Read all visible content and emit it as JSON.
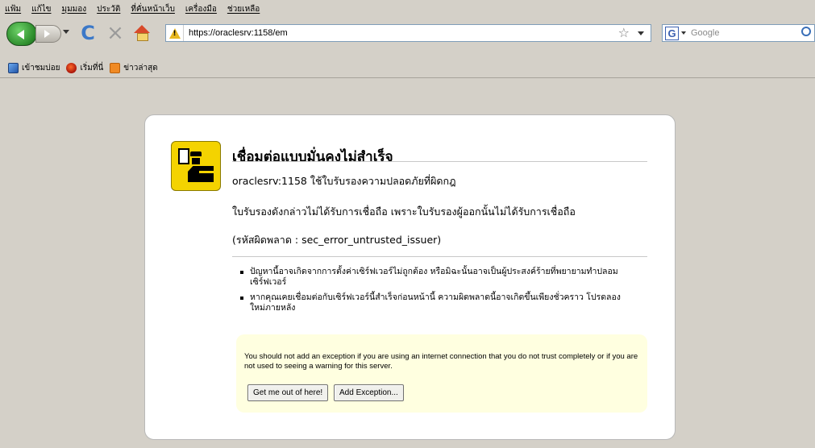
{
  "menu": {
    "items": [
      "แฟ้ม",
      "แก้ไข",
      "มุมมอง",
      "ประวัติ",
      "ที่คั่นหน้าเว็บ",
      "เครื่องมือ",
      "ช่วยเหลือ"
    ]
  },
  "navbar": {
    "url": "https://oraclesrv:1158/em",
    "search_placeholder": "Google"
  },
  "bookmarks": {
    "items": [
      "เข้าชมบ่อย",
      "เริ่มที่นี่",
      "ข่าวล่าสุด"
    ]
  },
  "error_page": {
    "title": "เชื่อมต่อแบบมั่นคงไม่สำเร็จ",
    "line1": "oraclesrv:1158 ใช้ใบรับรองความปลอดภัยที่ผิดกฎ",
    "line2": "ใบรับรองดังกล่าวไม่ได้รับการเชื่อถือ เพราะใบรับรองผู้ออกนั้นไม่ได้รับการเชื่อถือ",
    "line3": "(รหัสผิดพลาด : sec_error_untrusted_issuer)",
    "bullets": [
      "ปัญหานี้อาจเกิดจากการตั้งค่าเซิร์ฟเวอร์ไม่ถูกต้อง หรือมิฉะนั้นอาจเป็นผู้ประสงค์ร้ายที่พยายามทำปลอมเซิร์ฟเวอร์",
      "หากคุณเคยเชื่อมต่อกับเซิร์ฟเวอร์นี้สำเร็จก่อนหน้านี้ ความผิดพลาดนี้อาจเกิดขึ้นเพียงชั่วคราว โปรดลองใหม่ภายหลัง"
    ],
    "advice": "You should not add an exception if you are using an internet connection that you do not trust completely or if you are not used to seeing a warning for this server.",
    "btn_get_out": "Get me out of here!",
    "btn_add_exception": "Add Exception..."
  }
}
